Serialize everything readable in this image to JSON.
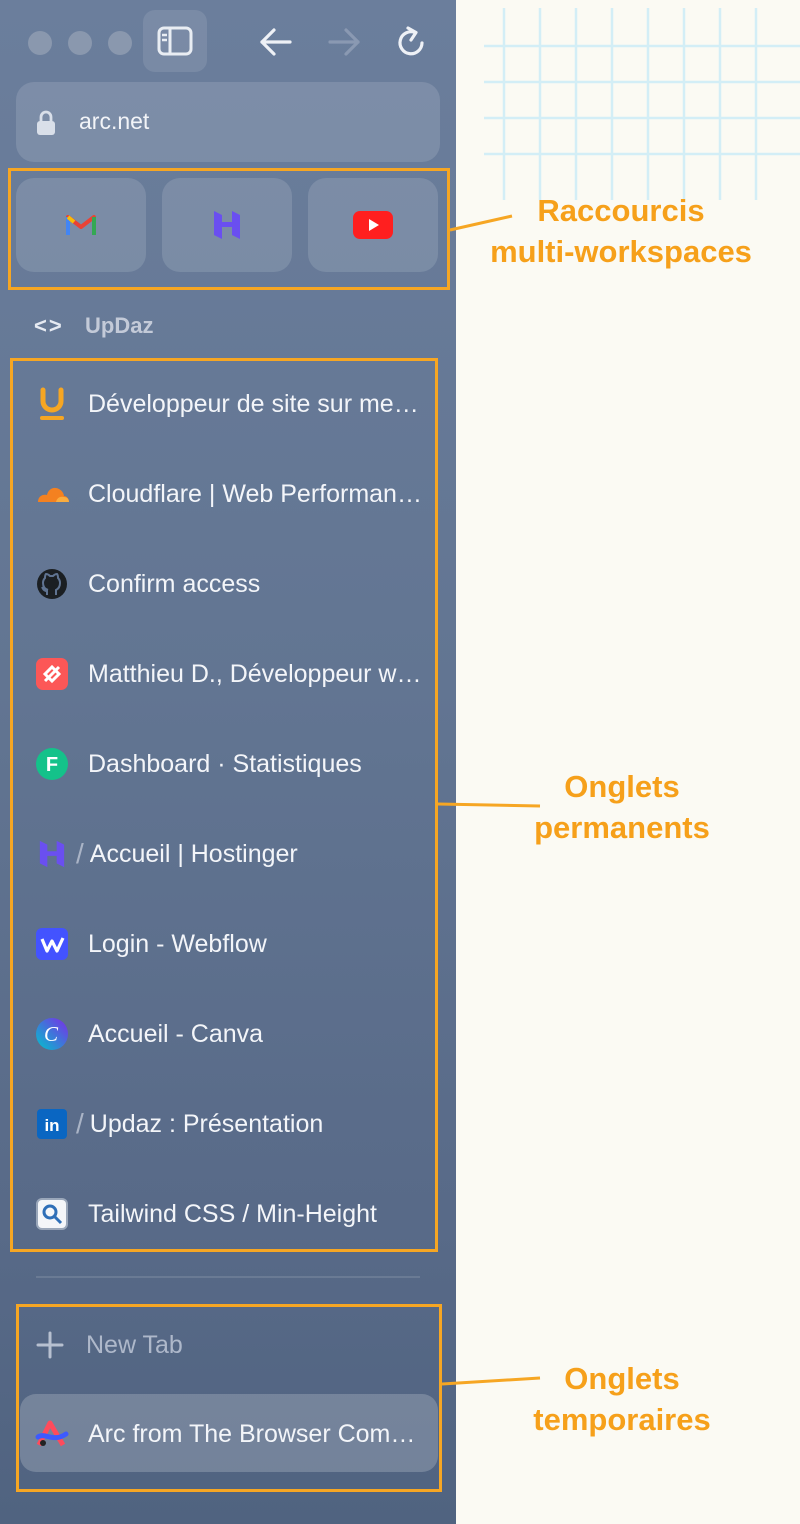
{
  "window": {
    "traffic_lights": [
      "close",
      "minimize",
      "zoom"
    ]
  },
  "toolbar": {
    "sidebar_toggle_icon": "sidebar-icon",
    "back_icon": "arrow-left-icon",
    "forward_icon": "arrow-right-icon",
    "reload_icon": "reload-icon"
  },
  "address_bar": {
    "url": "arc.net",
    "lock_icon": "lock-icon"
  },
  "pinned": [
    {
      "name": "Gmail",
      "icon": "gmail-icon"
    },
    {
      "name": "Hostinger",
      "icon": "hostinger-icon"
    },
    {
      "name": "YouTube",
      "icon": "youtube-icon"
    }
  ],
  "workspace": {
    "icon": "<>",
    "name": "UpDaz"
  },
  "tabs": [
    {
      "label": "Développeur de site sur mesure",
      "icon": "updaz-icon",
      "slash": ""
    },
    {
      "label": "Cloudflare | Web Performance & Security",
      "icon": "cloudflare-icon",
      "slash": ""
    },
    {
      "label": "Confirm access",
      "icon": "github-icon",
      "slash": ""
    },
    {
      "label": "Matthieu D., Développeur web",
      "icon": "malt-icon",
      "slash": ""
    },
    {
      "label": "Dashboard · Statistiques",
      "icon": "f-icon",
      "slash": ""
    },
    {
      "label": "Accueil | Hostinger",
      "icon": "hostinger-icon",
      "slash": "/"
    },
    {
      "label": "Login - Webflow",
      "icon": "webflow-icon",
      "slash": ""
    },
    {
      "label": "Accueil - Canva",
      "icon": "canva-icon",
      "slash": ""
    },
    {
      "label": "Updaz : Présentation",
      "icon": "linkedin-icon",
      "slash": "/"
    },
    {
      "label": "Tailwind CSS / Min-Height",
      "icon": "tailwind-icon",
      "slash": ""
    }
  ],
  "new_tab": {
    "label": "New Tab",
    "icon": "plus-icon"
  },
  "active_tab": {
    "label": "Arc from The Browser Company",
    "icon": "arc-icon"
  },
  "annotations": [
    {
      "text": "Raccourcis\nmulti-workspaces"
    },
    {
      "text": "Onglets\npermanents"
    },
    {
      "text": "Onglets\ntemporaires"
    }
  ],
  "colors": {
    "annotation": "#f6a623",
    "sidebar": "#627592",
    "page_background": "#fbfaf3",
    "grid": "#d3eef6"
  }
}
